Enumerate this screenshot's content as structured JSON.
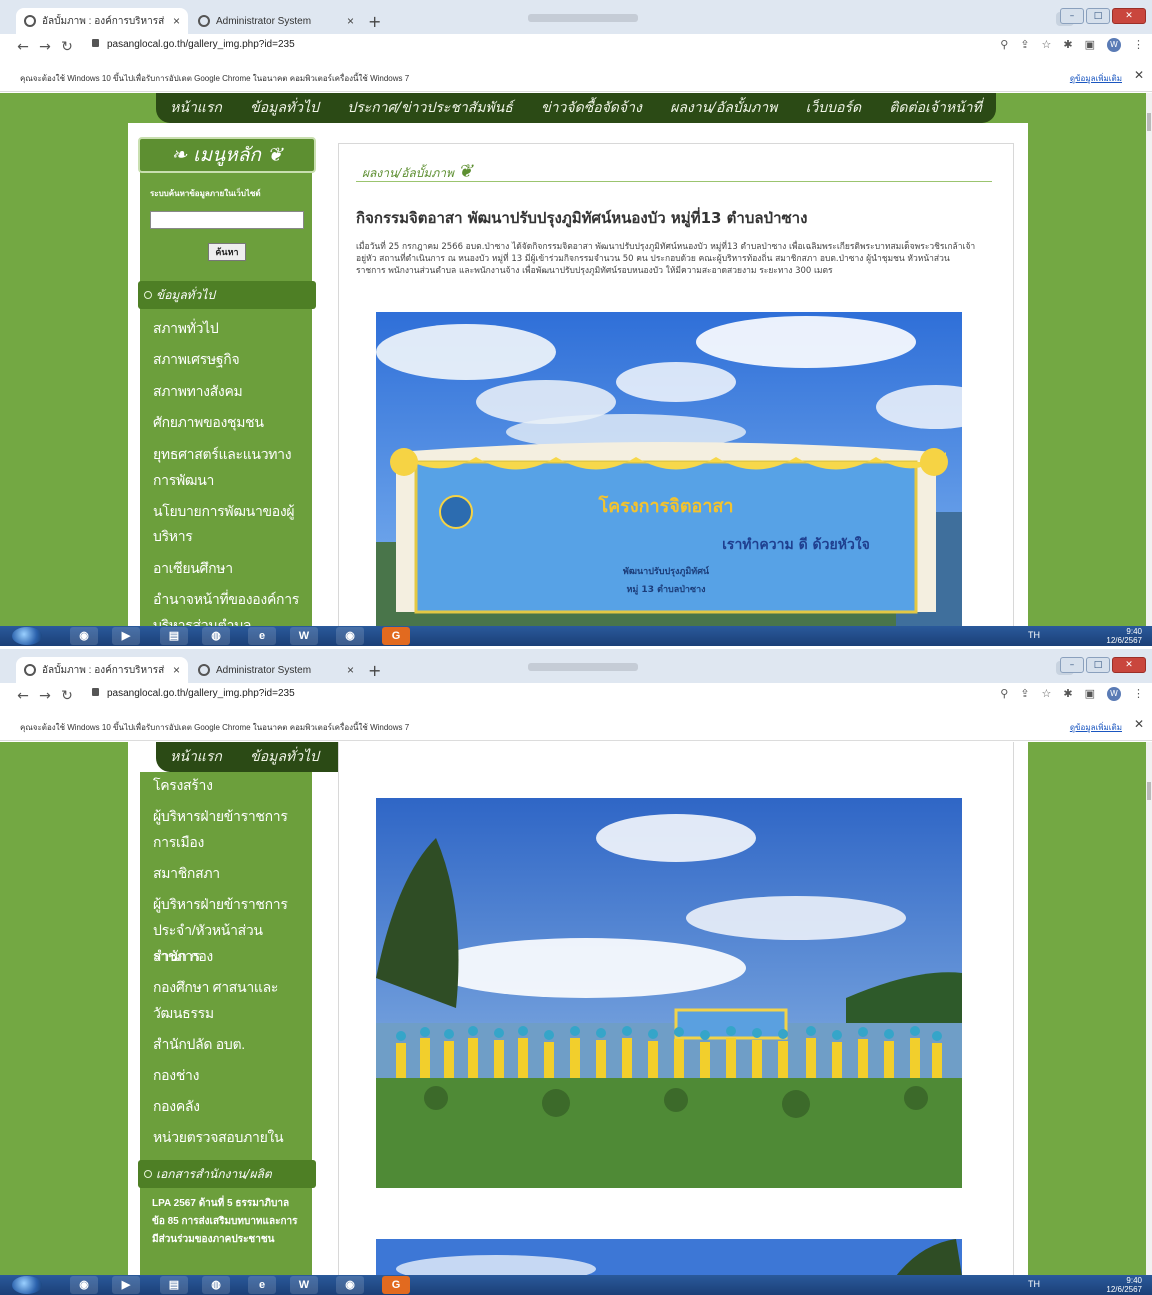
{
  "browser": {
    "tabs": [
      {
        "label": "อัลบั้มภาพ : องค์การบริหารส่วนตำบล"
      },
      {
        "label": "Administrator System"
      }
    ],
    "url": "pasanglocal.go.th/gallery_img.php?id=235",
    "infobar_message": "คุณจะต้องใช้ Windows 10 ขึ้นไปเพื่อรับการอัปเดต Google Chrome ในอนาคต คอมพิวเตอร์เครื่องนี้ใช้ Windows 7",
    "infobar_link": "ดูข้อมูลเพิ่มเติม",
    "profile_initial": "W"
  },
  "topnav": [
    "หน้าแรก",
    "ข้อมูลทั่วไป",
    "ประกาศ/ข่าวประชาสัมพันธ์",
    "ข่าวจัดซื้อจัดจ้าง",
    "ผลงาน/อัลบั้มภาพ",
    "เว็บบอร์ด",
    "ติดต่อเจ้าหน้าที่"
  ],
  "sidebar": {
    "menu_title": "เมนูหลัก",
    "search_label": "ระบบค้นหาข้อมูลภายในเว็บไซต์",
    "search_button": "ค้นหา",
    "section_general": "ข้อมูลทั่วไป",
    "items_top": [
      "สภาพทั่วไป",
      "สภาพเศรษฐกิจ",
      "สภาพทางสังคม",
      "ศักยภาพของชุมชน",
      "ยุทธศาสตร์และแนวทาง",
      "การพัฒนา",
      "นโยบายการพัฒนาของผู้",
      "บริหาร",
      "อาเซียนศึกษา",
      "อำนาจหน้าที่ขององค์การ",
      "บริหารส่วนตำบล"
    ],
    "items_bottom": [
      "โครงสร้าง",
      "ผู้บริหารฝ่ายข้าราชการ",
      "การเมือง",
      "สมาชิกสภา",
      "ผู้บริหารฝ่ายข้าราชการ",
      "ประจำ/หัวหน้าส่วนราชการ",
      "สำนัก กอง",
      "กองศึกษา ศาสนาและ",
      "วัฒนธรรม",
      "สำนักปลัด อบต.",
      "กองช่าง",
      "กองคลัง",
      "หน่วยตรวจสอบภายใน"
    ],
    "section_docs": "เอกสารสำนักงาน/ผลิต",
    "doc_item": "LPA 2567 ด้านที่ 5 ธรรมาภิบาล ข้อ 85 การส่งเสริมบทบาทและการมีส่วนร่วมของภาคประชาชน"
  },
  "content": {
    "section_title": "ผลงาน/อัลบั้มภาพ",
    "article_title": "กิจกรรมจิตอาสา พัฒนาปรับปรุงภูมิทัศน์หนองบัว หมู่ที่13 ตำบลป่าซาง",
    "article_body": "เมื่อวันที่ 25 กรกฎาคม 2566 อบต.ป่าซาง ได้จัดกิจกรรมจิตอาสา พัฒนาปรับปรุงภูมิทัศน์หนองบัว หมู่ที่13 ตำบลป่าซาง เพื่อเฉลิมพระเกียรติพระบาทสมเด็จพระวชิรเกล้าเจ้าอยู่หัว สถานที่ดำเนินการ ณ หนองบัว หมู่ที่ 13 มีผู้เข้าร่วมกิจกรรมจำนวน 50 คน ประกอบด้วย คณะผู้บริหารท้องถิ่น สมาชิกสภา อบต.ป่าซาง ผู้นำชุมชน หัวหน้าส่วนราชการ พนักงานส่วนตำบล และพนักงานจ้าง เพื่อพัฒนาปรับปรุงภูมิทัศน์รอบหนองบัว ให้มีความสะอาดสวยงาม ระยะทาง 300 เมตร",
    "banner_title": "โครงการจิตอาสา",
    "banner_slogan": "เราทำความ ดี ด้วยหัวใจ",
    "banner_line1": "พัฒนาปรับปรุงภูมิทัศน์",
    "banner_line2": "หมู่ 13 ตำบลป่าซาง"
  },
  "taskbar": {
    "lang": "TH",
    "time": "9:40",
    "date": "12/6/2567",
    "word_label": "W"
  },
  "colors": {
    "page_green": "#73a843",
    "nav_dark": "#2b4a15",
    "sidebar_green": "#6c9f3c"
  }
}
